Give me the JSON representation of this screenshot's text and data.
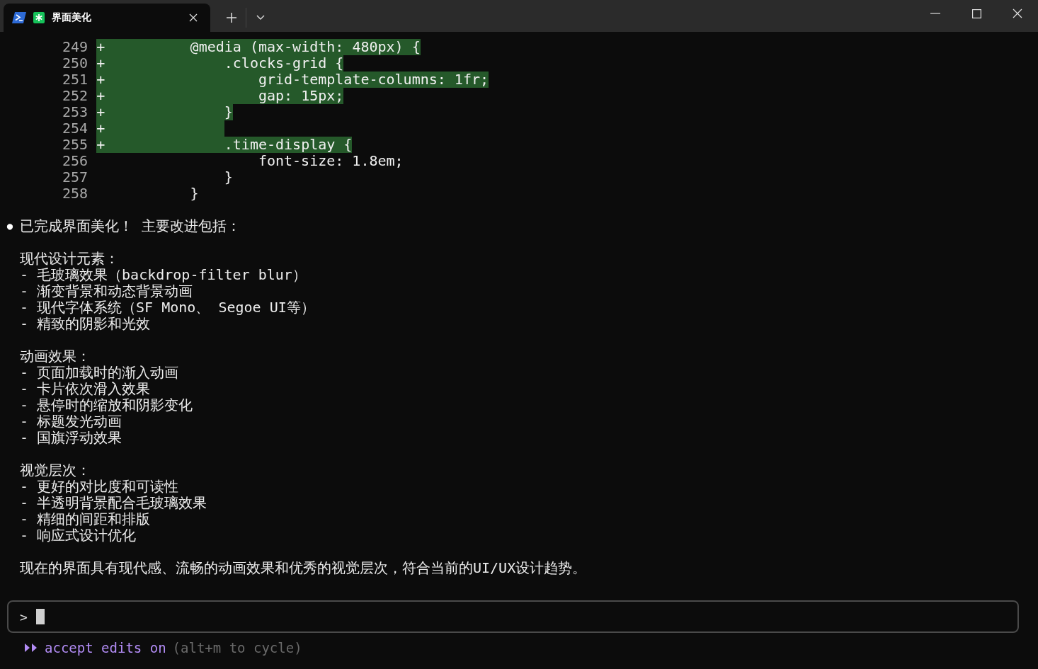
{
  "tab": {
    "title": "界面美化",
    "selected": true
  },
  "diff": [
    {
      "number": "249",
      "added": true,
      "marker": "+",
      "code": "          @media (max-width: 480px) {"
    },
    {
      "number": "250",
      "added": true,
      "marker": "+",
      "code": "              .clocks-grid {"
    },
    {
      "number": "251",
      "added": true,
      "marker": "+",
      "code": "                  grid-template-columns: 1fr;"
    },
    {
      "number": "252",
      "added": true,
      "marker": "+",
      "code": "                  gap: 15px;"
    },
    {
      "number": "253",
      "added": true,
      "marker": "+",
      "code": "              }"
    },
    {
      "number": "254",
      "added": true,
      "marker": "+"
    },
    {
      "number": "255",
      "added": true,
      "marker": "+",
      "code": "              .time-display {"
    },
    {
      "number": "256",
      "added": false,
      "code": "                  font-size: 1.8em;"
    },
    {
      "number": "257",
      "added": false,
      "code": "              }"
    },
    {
      "number": "258",
      "added": false,
      "code": "          }"
    }
  ],
  "message": {
    "bullet": "●",
    "paragraphs": [
      [
        "已完成界面美化！ 主要改进包括："
      ],
      [
        "现代设计元素：",
        "- 毛玻璃效果（backdrop-filter blur）",
        "- 渐变背景和动态背景动画",
        "- 现代字体系统（SF Mono、 Segoe UI等）",
        "- 精致的阴影和光效"
      ],
      [
        "动画效果：",
        "- 页面加载时的渐入动画",
        "- 卡片依次滑入效果",
        "- 悬停时的缩放和阴影变化",
        "- 标题发光动画",
        "- 国旗浮动效果"
      ],
      [
        "视觉层次：",
        "- 更好的对比度和可读性",
        "- 半透明背景配合毛玻璃效果",
        "- 精细的间距和排版",
        "- 响应式设计优化"
      ],
      [
        "现在的界面具有现代感、流畅的动画效果和优秀的视觉层次，符合当前的UI/UX设计趋势。"
      ]
    ]
  },
  "prompt": {
    "symbol": ">"
  },
  "mode": {
    "label": "accept edits on",
    "hint": "(alt+m to cycle)"
  }
}
